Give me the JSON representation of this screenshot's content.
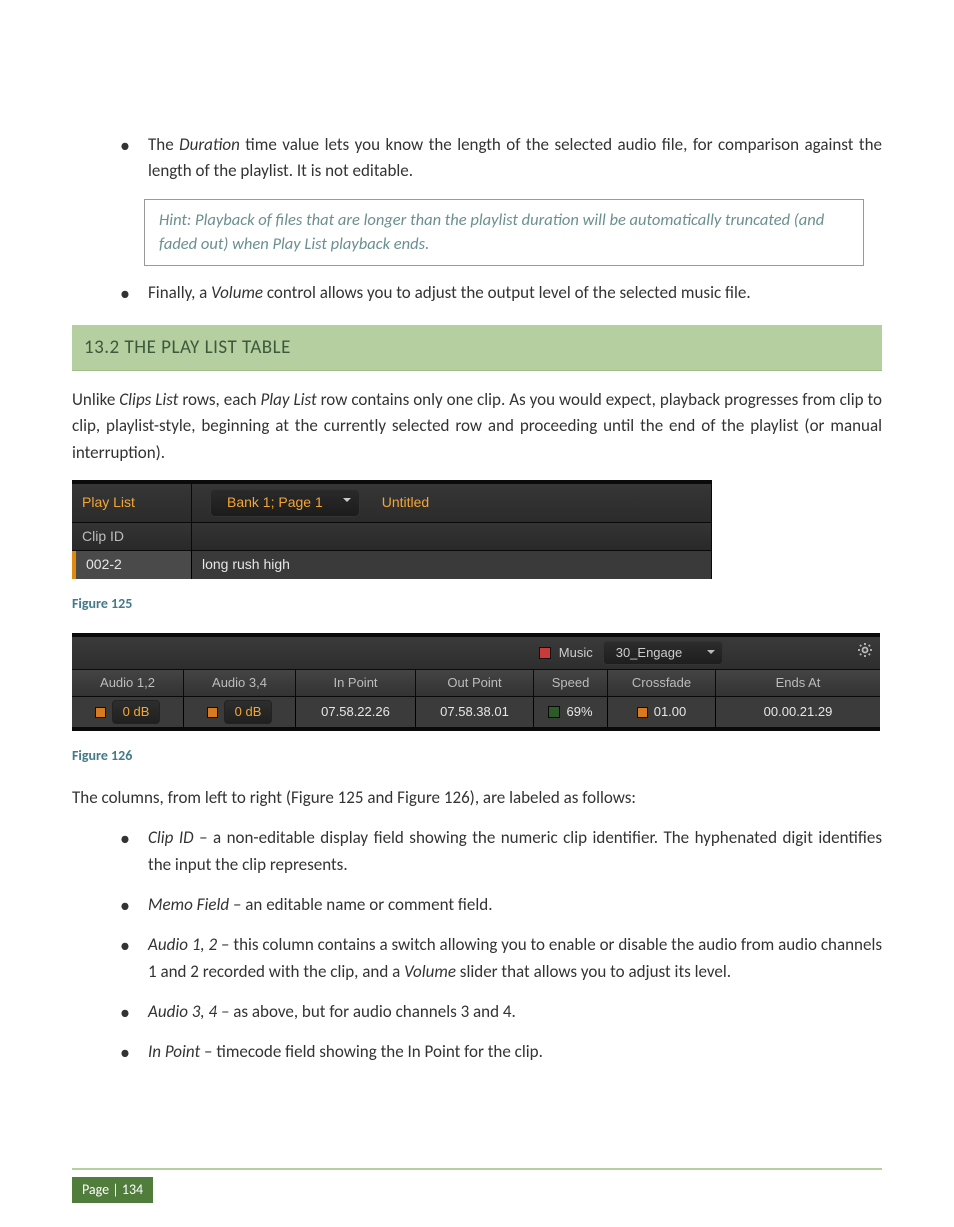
{
  "bullets1": {
    "b1_pre": "The ",
    "b1_em": "Duration",
    "b1_post": " time value lets you know the length of the selected audio file, for comparison against the length of the playlist.  It is not editable."
  },
  "hint": "Hint: Playback of files that are longer than the playlist duration will be automatically truncated (and faded out) when Play List playback ends.",
  "bullets2": {
    "b2_pre": "Finally, a ",
    "b2_em": "Volume",
    "b2_post": " control allows you to adjust the output level of the selected music file."
  },
  "section_head": "13.2  THE PLAY LIST TABLE",
  "intro_para": "Unlike Clips List rows, each Play List row contains only one clip.  As you would expect, playback progresses from clip to clip, playlist-style, beginning at the currently selected row and proceeding until the end of the playlist (or manual interruption).",
  "intro_em1": "Clips List",
  "intro_em2": "Play List",
  "fig125": {
    "playlist_label": "Play List",
    "bank_label": "Bank 1; Page 1",
    "title_label": "Untitled",
    "clipid_header": "Clip ID",
    "clipid_value": "002-2",
    "memo_value": "long rush high"
  },
  "fig125_caption": "Figure 125",
  "fig126": {
    "music_label": "Music",
    "music_file": "30_Engage",
    "cols": {
      "audio12": "Audio 1,2",
      "audio34": "Audio 3,4",
      "inpoint": "In Point",
      "outpoint": "Out Point",
      "speed": "Speed",
      "crossfade": "Crossfade",
      "endsat": "Ends At"
    },
    "vals": {
      "audio12": "0 dB",
      "audio34": "0 dB",
      "inpoint": "07.58.22.26",
      "outpoint": "07.58.38.01",
      "speed": "69%",
      "crossfade": "01.00",
      "endsat": "00.00.21.29"
    }
  },
  "fig126_caption": "Figure 126",
  "columns_intro": "The columns, from left to right (Figure 125 and Figure 126), are labeled as follows:",
  "cols_desc": {
    "clipid_em": "Clip ID",
    "clipid_txt": " – a non-editable display field showing the numeric clip identifier.  The hyphenated digit identifies the input the clip represents.",
    "memo_em": "Memo Field",
    "memo_txt": " – an editable name or comment field.",
    "a12_em": "Audio 1, 2",
    "a12_txt": " – this column contains a switch allowing you to enable or disable the audio from audio channels 1 and 2 recorded with the clip, and a ",
    "a12_em2": "Volume",
    "a12_txt2": " slider that allows you to adjust its level.",
    "a34_em": "Audio 3, 4 –",
    "a34_txt": " as above, but for audio channels 3 and 4.",
    "in_em": "In Point",
    "in_txt": " – timecode field showing the In Point for the clip."
  },
  "footer": "Page | 134"
}
